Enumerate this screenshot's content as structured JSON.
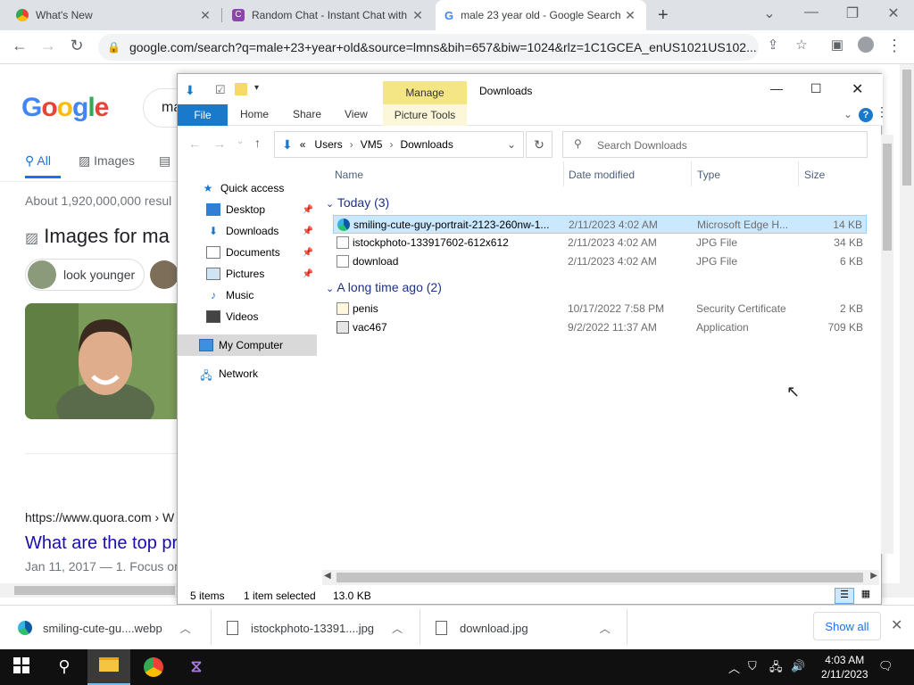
{
  "browser": {
    "tabs": [
      {
        "title": "What's New",
        "icon": "chrome-icon"
      },
      {
        "title": "Random Chat - Instant Chat with",
        "icon": "chat-favicon"
      },
      {
        "title": "male 23 year old - Google Search",
        "icon": "google-icon"
      }
    ],
    "new_tab": "+",
    "url": "google.com/search?q=male+23+year+old&source=lmns&bih=657&biw=1024&rlz=1C1GCEA_enUS1021US102..."
  },
  "google": {
    "logo": "Google",
    "query_fragment": "ma",
    "tabs": [
      "All",
      "Images",
      ""
    ],
    "stats": "About 1,920,000,000 resul",
    "images_heading": "Images for ma",
    "chip": "look younger",
    "cite": "https://www.quora.com › W",
    "result_title": "What are the top pr",
    "result_date": "Jan 11, 2017 — 1. Focus on"
  },
  "explorer": {
    "manage": "Manage",
    "title": "Downloads",
    "ribbon": {
      "file": "File",
      "home": "Home",
      "share": "Share",
      "view": "View",
      "picture_tools": "Picture Tools"
    },
    "breadcrumb": [
      "«",
      "Users",
      "VM5",
      "Downloads"
    ],
    "search_placeholder": "Search Downloads",
    "nav": [
      {
        "label": "Quick access",
        "icon": "star-icon"
      },
      {
        "label": "Desktop",
        "icon": "desktop-icon",
        "pinned": true
      },
      {
        "label": "Downloads",
        "icon": "download-arrow-icon",
        "pinned": true
      },
      {
        "label": "Documents",
        "icon": "documents-icon",
        "pinned": true
      },
      {
        "label": "Pictures",
        "icon": "pictures-icon",
        "pinned": true
      },
      {
        "label": "Music",
        "icon": "music-icon"
      },
      {
        "label": "Videos",
        "icon": "videos-icon"
      },
      {
        "label": "My Computer",
        "icon": "computer-icon"
      },
      {
        "label": "Network",
        "icon": "network-icon"
      }
    ],
    "columns": [
      "Name",
      "Date modified",
      "Type",
      "Size"
    ],
    "groups": [
      {
        "label": "Today (3)",
        "files": [
          {
            "name": "smiling-cute-guy-portrait-2123-260nw-1...",
            "date": "2/11/2023 4:02 AM",
            "type": "Microsoft Edge H...",
            "size": "14 KB",
            "selected": true
          },
          {
            "name": "istockphoto-133917602-612x612",
            "date": "2/11/2023 4:02 AM",
            "type": "JPG File",
            "size": "34 KB"
          },
          {
            "name": "download",
            "date": "2/11/2023 4:02 AM",
            "type": "JPG File",
            "size": "6 KB"
          }
        ]
      },
      {
        "label": "A long time ago (2)",
        "files": [
          {
            "name": "penis",
            "date": "10/17/2022 7:58 PM",
            "type": "Security Certificate",
            "size": "2 KB"
          },
          {
            "name": "vac467",
            "date": "9/2/2022 11:37 AM",
            "type": "Application",
            "size": "709 KB"
          }
        ]
      }
    ],
    "status": {
      "items": "5 items",
      "selected": "1 item selected",
      "size": "13.0 KB"
    }
  },
  "downloads_bar": {
    "items": [
      "smiling-cute-gu....webp",
      "istockphoto-13391....jpg",
      "download.jpg"
    ],
    "show_all": "Show all"
  },
  "taskbar": {
    "time": "4:03 AM",
    "date": "2/11/2023"
  }
}
